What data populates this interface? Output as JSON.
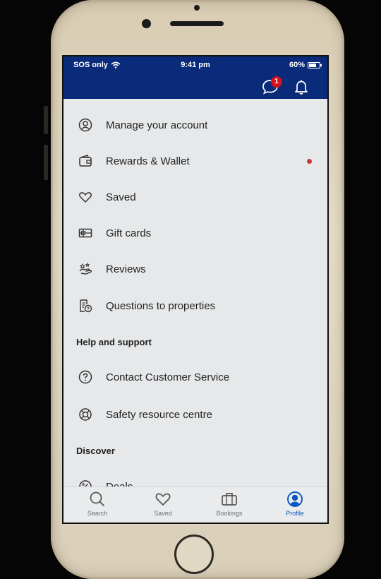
{
  "status_bar": {
    "carrier": "SOS only",
    "time": "9:41 pm",
    "battery": "60%"
  },
  "header": {
    "messages_badge": "1"
  },
  "menu": {
    "items": [
      {
        "label": "Manage your account",
        "icon": "user-circle-icon"
      },
      {
        "label": "Rewards & Wallet",
        "icon": "wallet-icon",
        "has_dot": true
      },
      {
        "label": "Saved",
        "icon": "heart-icon"
      },
      {
        "label": "Gift cards",
        "icon": "gift-card-icon"
      },
      {
        "label": "Reviews",
        "icon": "reviews-icon"
      },
      {
        "label": "Questions to properties",
        "icon": "question-doc-icon"
      }
    ],
    "help_section": "Help and support",
    "help_items": [
      {
        "label": "Contact Customer Service",
        "icon": "question-circle-icon"
      },
      {
        "label": "Safety resource centre",
        "icon": "lifebuoy-icon"
      }
    ],
    "discover_section": "Discover",
    "discover_items": [
      {
        "label": "Deals",
        "icon": "percent-icon"
      }
    ]
  },
  "tabs": [
    {
      "label": "Search",
      "icon": "search-icon"
    },
    {
      "label": "Saved",
      "icon": "heart-icon"
    },
    {
      "label": "Bookings",
      "icon": "suitcase-icon"
    },
    {
      "label": "Profile",
      "icon": "profile-icon",
      "active": true
    }
  ],
  "colors": {
    "header": "#0a2b7a",
    "badge": "#d4111e",
    "active_tab": "#0a57c2"
  }
}
